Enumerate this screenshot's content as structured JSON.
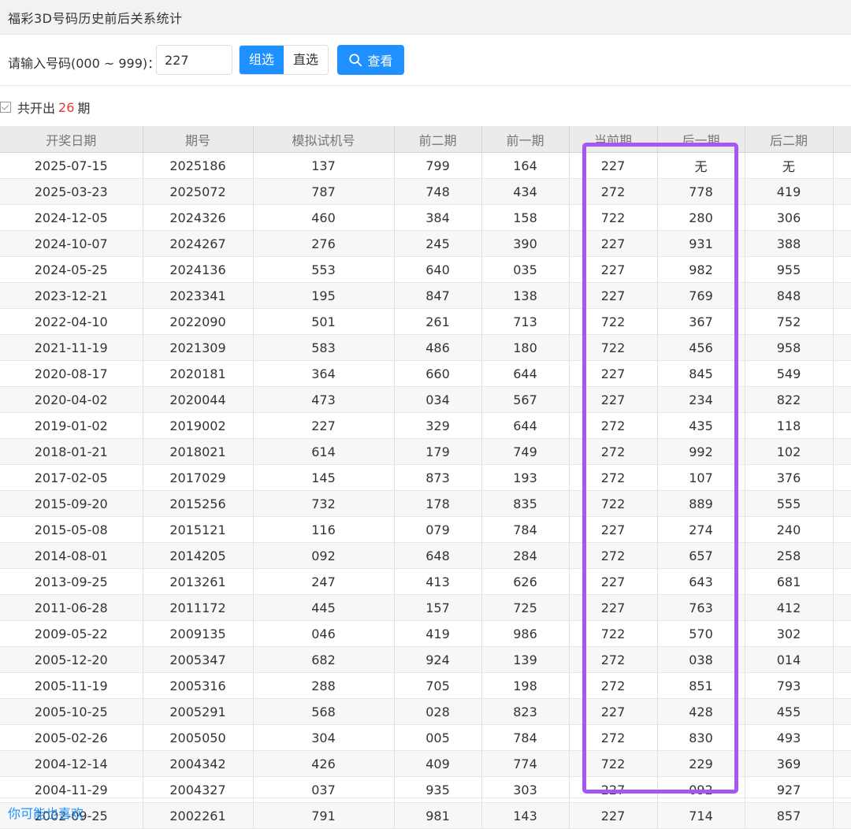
{
  "title": "福彩3D号码历史前后关系统计",
  "search": {
    "label": "请输入号码(000 ~ 999)：",
    "value": "227",
    "mode_group": "组选",
    "mode_direct": "直选",
    "view_button": "查看",
    "view_icon": "search-icon"
  },
  "summary": {
    "prefix": "共开出",
    "count": "26",
    "suffix": "期"
  },
  "table": {
    "headers": [
      "开奖日期",
      "期号",
      "模拟试机号",
      "前二期",
      "前一期",
      "当前期",
      "后一期",
      "后二期"
    ],
    "rows": [
      [
        "2025-07-15",
        "2025186",
        "137",
        "799",
        "164",
        "227",
        "无",
        "无"
      ],
      [
        "2025-03-23",
        "2025072",
        "787",
        "748",
        "434",
        "272",
        "778",
        "419"
      ],
      [
        "2024-12-05",
        "2024326",
        "460",
        "384",
        "158",
        "722",
        "280",
        "306"
      ],
      [
        "2024-10-07",
        "2024267",
        "276",
        "245",
        "390",
        "227",
        "931",
        "388"
      ],
      [
        "2024-05-25",
        "2024136",
        "553",
        "640",
        "035",
        "227",
        "982",
        "955"
      ],
      [
        "2023-12-21",
        "2023341",
        "195",
        "847",
        "138",
        "227",
        "769",
        "848"
      ],
      [
        "2022-04-10",
        "2022090",
        "501",
        "261",
        "713",
        "722",
        "367",
        "752"
      ],
      [
        "2021-11-19",
        "2021309",
        "583",
        "486",
        "180",
        "722",
        "456",
        "958"
      ],
      [
        "2020-08-17",
        "2020181",
        "364",
        "660",
        "644",
        "227",
        "845",
        "549"
      ],
      [
        "2020-04-02",
        "2020044",
        "473",
        "034",
        "567",
        "227",
        "234",
        "822"
      ],
      [
        "2019-01-02",
        "2019002",
        "227",
        "329",
        "644",
        "272",
        "435",
        "118"
      ],
      [
        "2018-01-21",
        "2018021",
        "614",
        "179",
        "749",
        "272",
        "992",
        "102"
      ],
      [
        "2017-02-05",
        "2017029",
        "145",
        "873",
        "193",
        "272",
        "107",
        "376"
      ],
      [
        "2015-09-20",
        "2015256",
        "732",
        "178",
        "835",
        "722",
        "889",
        "555"
      ],
      [
        "2015-05-08",
        "2015121",
        "116",
        "079",
        "784",
        "227",
        "274",
        "240"
      ],
      [
        "2014-08-01",
        "2014205",
        "092",
        "648",
        "284",
        "272",
        "657",
        "258"
      ],
      [
        "2013-09-25",
        "2013261",
        "247",
        "413",
        "626",
        "227",
        "643",
        "681"
      ],
      [
        "2011-06-28",
        "2011172",
        "445",
        "157",
        "725",
        "227",
        "763",
        "412"
      ],
      [
        "2009-05-22",
        "2009135",
        "046",
        "419",
        "986",
        "722",
        "570",
        "302"
      ],
      [
        "2005-12-20",
        "2005347",
        "682",
        "924",
        "139",
        "272",
        "038",
        "014"
      ],
      [
        "2005-11-19",
        "2005316",
        "288",
        "705",
        "198",
        "272",
        "851",
        "793"
      ],
      [
        "2005-10-25",
        "2005291",
        "568",
        "028",
        "823",
        "227",
        "428",
        "455"
      ],
      [
        "2005-02-26",
        "2005050",
        "304",
        "005",
        "784",
        "272",
        "830",
        "493"
      ],
      [
        "2004-12-14",
        "2004342",
        "426",
        "409",
        "774",
        "722",
        "229",
        "369"
      ],
      [
        "2004-11-29",
        "2004327",
        "037",
        "935",
        "303",
        "227",
        "092",
        "927"
      ],
      [
        "2002-09-25",
        "2002261",
        "791",
        "981",
        "143",
        "227",
        "714",
        "857"
      ]
    ]
  },
  "footer": {
    "text": "你可能也喜欢"
  },
  "colors": {
    "accent": "#1e90ff",
    "highlight": "#a855f7",
    "count": "#e0393e"
  }
}
